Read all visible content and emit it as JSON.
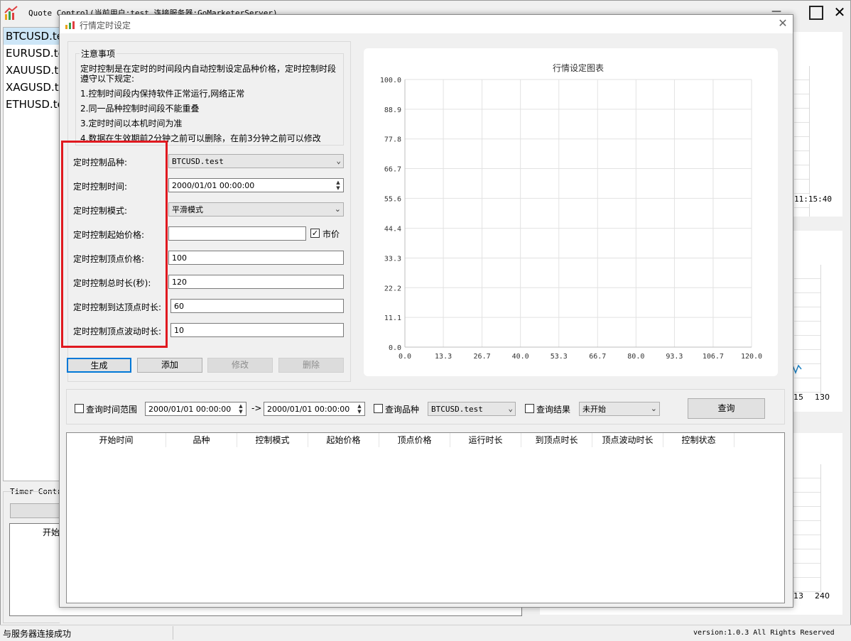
{
  "main_window": {
    "title": "Quote Control(当前用户:test 连接服务器:GoMarketerServer)",
    "symbols": [
      "BTCUSD.te",
      "EURUSD.te",
      "XAUUSD.te",
      "XAGUSD.te",
      "ETHUSD.te"
    ],
    "timer_group_label": "Timer Contro",
    "timer_header": "开始",
    "bg_chart1_time": "11:15:40",
    "bg_chart2_ticks": [
      "15",
      "130"
    ],
    "bg_chart3_ticks": [
      "13",
      "240"
    ],
    "status_left": "与服务器连接成功",
    "status_right": "version:1.0.3 All Rights Reserved"
  },
  "dialog": {
    "title": "行情定时设定",
    "notice": {
      "legend": "注意事项",
      "line1": "定时控制是在定时的时间段内自动控制设定品种价格，定时控制时段",
      "line2": "遵守以下规定:",
      "rule1": "1.控制时间段内保持软件正常运行,网络正常",
      "rule2": "2.同一品种控制时间段不能重叠",
      "rule3": "3.定时时间以本机时间为准",
      "rule4": "4.数据在生效期前2分钟之前可以删除，在前3分钟之前可以修改"
    },
    "form": {
      "symbol_label": "定时控制品种:",
      "symbol_value": "BTCUSD.test",
      "time_label": "定时控制时间:",
      "time_value": "2000/01/01 00:00:00",
      "mode_label": "定时控制模式:",
      "mode_value": "平滑模式",
      "start_price_label": "定时控制起始价格:",
      "start_price_value": "",
      "market_price_label": "市价",
      "market_price_checked": true,
      "peak_price_label": "定时控制顶点价格:",
      "peak_price_value": "100",
      "duration_label": "定时控制总时长(秒):",
      "duration_value": "120",
      "to_peak_label": "定时控制到达顶点时长:",
      "to_peak_value": "60",
      "peak_wave_label": "定时控制顶点波动时长:",
      "peak_wave_value": "10"
    },
    "buttons": {
      "generate": "生成",
      "add": "添加",
      "modify": "修改",
      "delete": "删除"
    },
    "query": {
      "time_range_label": "查询时间范围",
      "time_from": "2000/01/01 00:00:00",
      "arrow": "->",
      "time_to": "2000/01/01 00:00:00",
      "symbol_label": "查询品种",
      "symbol_value": "BTCUSD.test",
      "result_label": "查询结果",
      "result_value": "未开始",
      "query_button": "查询"
    },
    "table": {
      "columns": [
        "开始时间",
        "品种",
        "控制模式",
        "起始价格",
        "顶点价格",
        "运行时长",
        "到顶点时长",
        "顶点波动时长",
        "控制状态"
      ]
    }
  },
  "highlight_color": "#e0191f",
  "chart_data": {
    "type": "line",
    "title": "行情设定图表",
    "x_ticks": [
      "0.0",
      "13.3",
      "26.7",
      "40.0",
      "53.3",
      "66.7",
      "80.0",
      "93.3",
      "106.7",
      "120.0"
    ],
    "y_ticks": [
      "0.0",
      "11.1",
      "22.2",
      "33.3",
      "44.4",
      "55.6",
      "66.7",
      "77.8",
      "88.9",
      "100.0"
    ],
    "xlim": [
      0,
      120
    ],
    "ylim": [
      0,
      100
    ],
    "grid": true,
    "series": []
  }
}
